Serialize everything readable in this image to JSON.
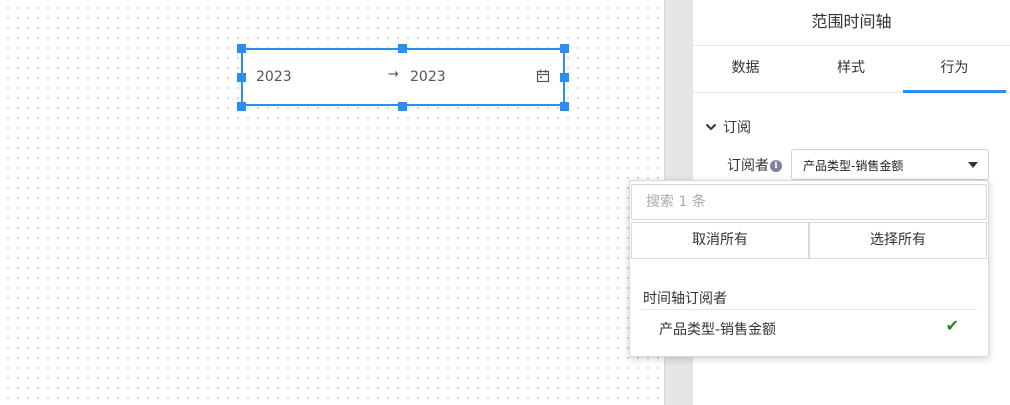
{
  "widget": {
    "start_value": "2023",
    "separator": "→",
    "end_value": "2023",
    "calendar_icon": "calendar-icon"
  },
  "panel": {
    "title": "范围时间轴",
    "tabs": [
      {
        "label": "数据",
        "active": false
      },
      {
        "label": "样式",
        "active": false
      },
      {
        "label": "行为",
        "active": true
      }
    ],
    "section": {
      "label": "订阅",
      "icon": "chevron-down-icon"
    },
    "subscriber": {
      "label": "订阅者",
      "info_icon": "info-icon",
      "selected": "产品类型-销售金额"
    }
  },
  "dropdown": {
    "search_placeholder": "搜索 1 条",
    "cancel_all_label": "取消所有",
    "select_all_label": "选择所有",
    "group_label": "时间轴订阅者",
    "options": [
      {
        "label": "产品类型-销售金额",
        "checked": true
      }
    ]
  },
  "colors": {
    "accent": "#2b8ff1",
    "check": "#1e8a1e"
  }
}
